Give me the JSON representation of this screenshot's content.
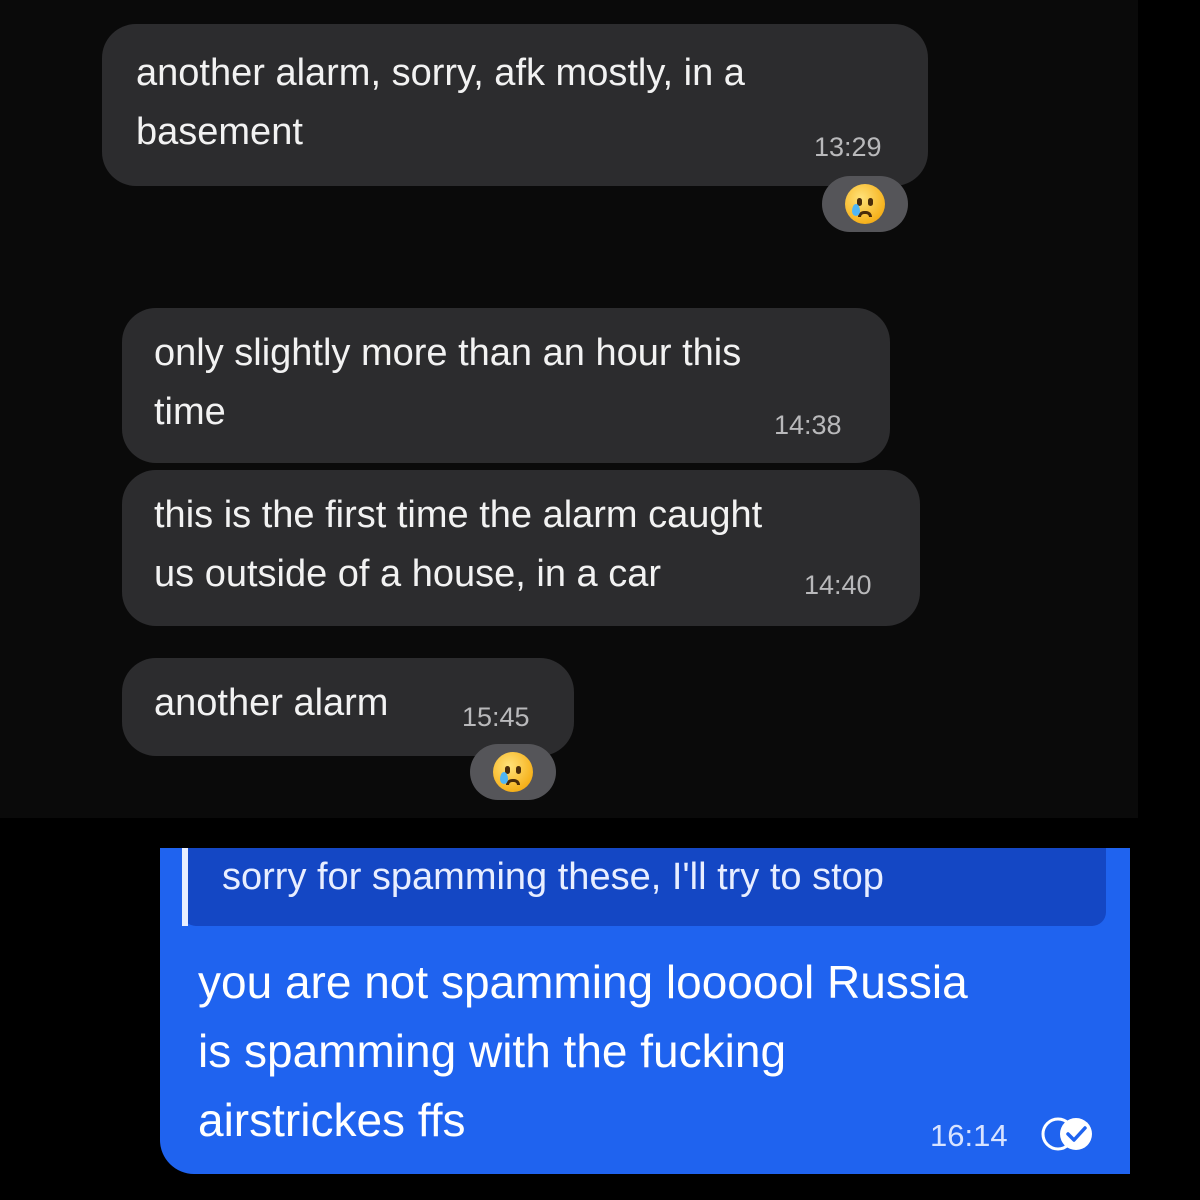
{
  "messages": [
    {
      "text": "another alarm, sorry, afk mostly, in a\nbasement",
      "time": "13:29",
      "reaction": "crying-face"
    },
    {
      "text": "only slightly more than an hour this\ntime",
      "time": "14:38"
    },
    {
      "text": "this is the first time the alarm caught\nus outside of a house, in a car",
      "time": "14:40"
    },
    {
      "text": "another alarm",
      "time": "15:45",
      "reaction": "crying-face"
    }
  ],
  "reply": {
    "quoted_text": "sorry for spamming these, I'll try to stop",
    "text": "you are not spamming loooool Russia\nis spamming with the fucking\nairstrickes ffs",
    "time": "16:14",
    "status_icon": "double-check-icon"
  },
  "colors": {
    "incoming_bubble": "#2c2c2e",
    "outgoing_bubble": "#1f63ef",
    "quote_background": "#1447c4",
    "background": "#000000"
  }
}
